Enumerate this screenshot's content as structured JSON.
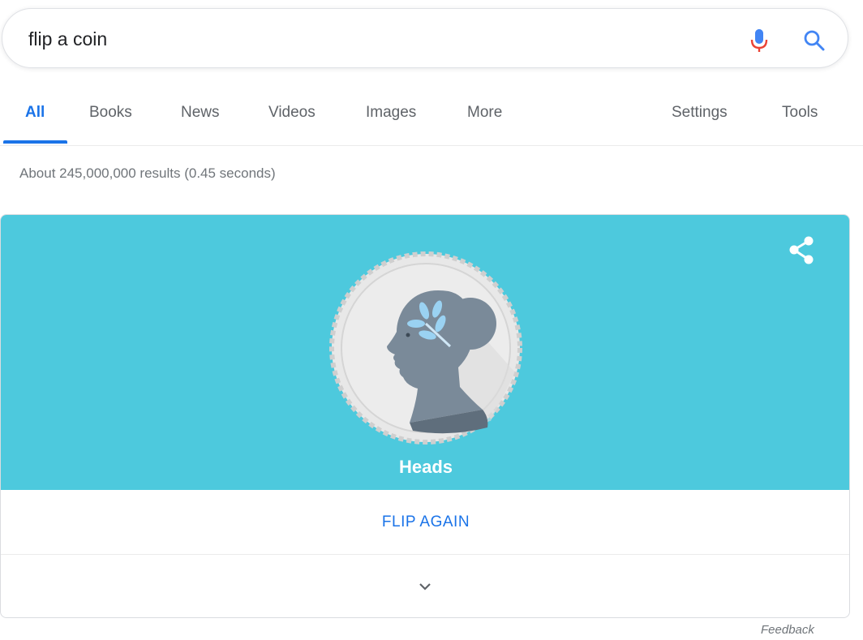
{
  "search": {
    "query": "flip a coin",
    "icons": {
      "mic": "microphone-icon",
      "search": "search-icon"
    },
    "colors": {
      "mic_blue": "#4285f4",
      "mic_red": "#ea4335",
      "search_blue": "#4285f4"
    }
  },
  "tabs": {
    "items": [
      {
        "label": "All",
        "active": true
      },
      {
        "label": "Books",
        "active": false
      },
      {
        "label": "News",
        "active": false
      },
      {
        "label": "Videos",
        "active": false
      },
      {
        "label": "Images",
        "active": false
      },
      {
        "label": "More",
        "active": false
      }
    ],
    "right": [
      {
        "label": "Settings"
      },
      {
        "label": "Tools"
      }
    ],
    "active_color": "#1a73e8"
  },
  "stats": {
    "text": "About 245,000,000 results (0.45 seconds)"
  },
  "coin_card": {
    "banner_color": "#4dc9dd",
    "result": "Heads",
    "flip_label": "FLIP AGAIN",
    "icons": {
      "share": "share-icon",
      "expand": "chevron-down-icon",
      "coin": "coin-heads-icon"
    }
  },
  "feedback": {
    "label": "Feedback"
  }
}
